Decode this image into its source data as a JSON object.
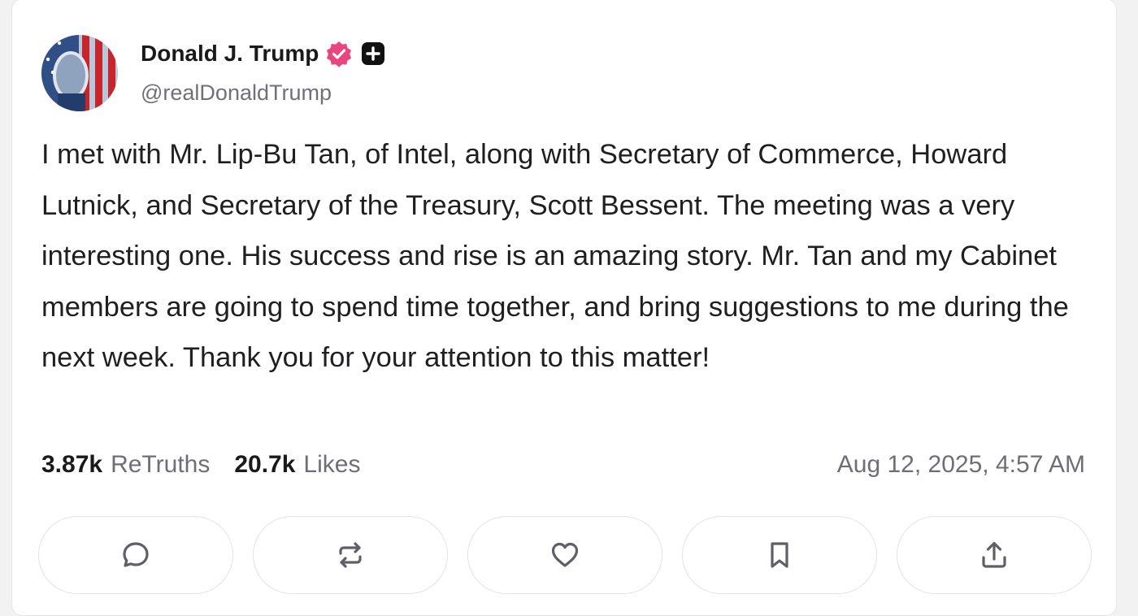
{
  "post": {
    "author": {
      "display_name": "Donald J. Trump",
      "handle": "@realDonaldTrump",
      "verified_badge_icon": "verified-check-icon",
      "plus_badge_icon": "plus-badge-icon"
    },
    "text": "I met with Mr. Lip-Bu Tan, of Intel, along with Secretary of Commerce, Howard Lutnick, and Secretary of the Treasury, Scott Bessent. The meeting was a very interesting one. His success and rise is an amazing story. Mr. Tan and my Cabinet members are going to spend time together, and bring suggestions to me during the next week. Thank you for your attention to this matter!",
    "stats": {
      "retruths_count": "3.87k",
      "retruths_label": "ReTruths",
      "likes_count": "20.7k",
      "likes_label": "Likes"
    },
    "timestamp": "Aug 12, 2025, 4:57 AM"
  },
  "actions": [
    {
      "icon": "reply-icon"
    },
    {
      "icon": "retruth-icon"
    },
    {
      "icon": "like-heart-icon"
    },
    {
      "icon": "bookmark-icon"
    },
    {
      "icon": "share-icon"
    }
  ],
  "colors": {
    "verified_badge": "#e8467c",
    "text_primary": "#1a1a1a",
    "text_secondary": "#6e6e76",
    "border": "#e3e3e7"
  }
}
